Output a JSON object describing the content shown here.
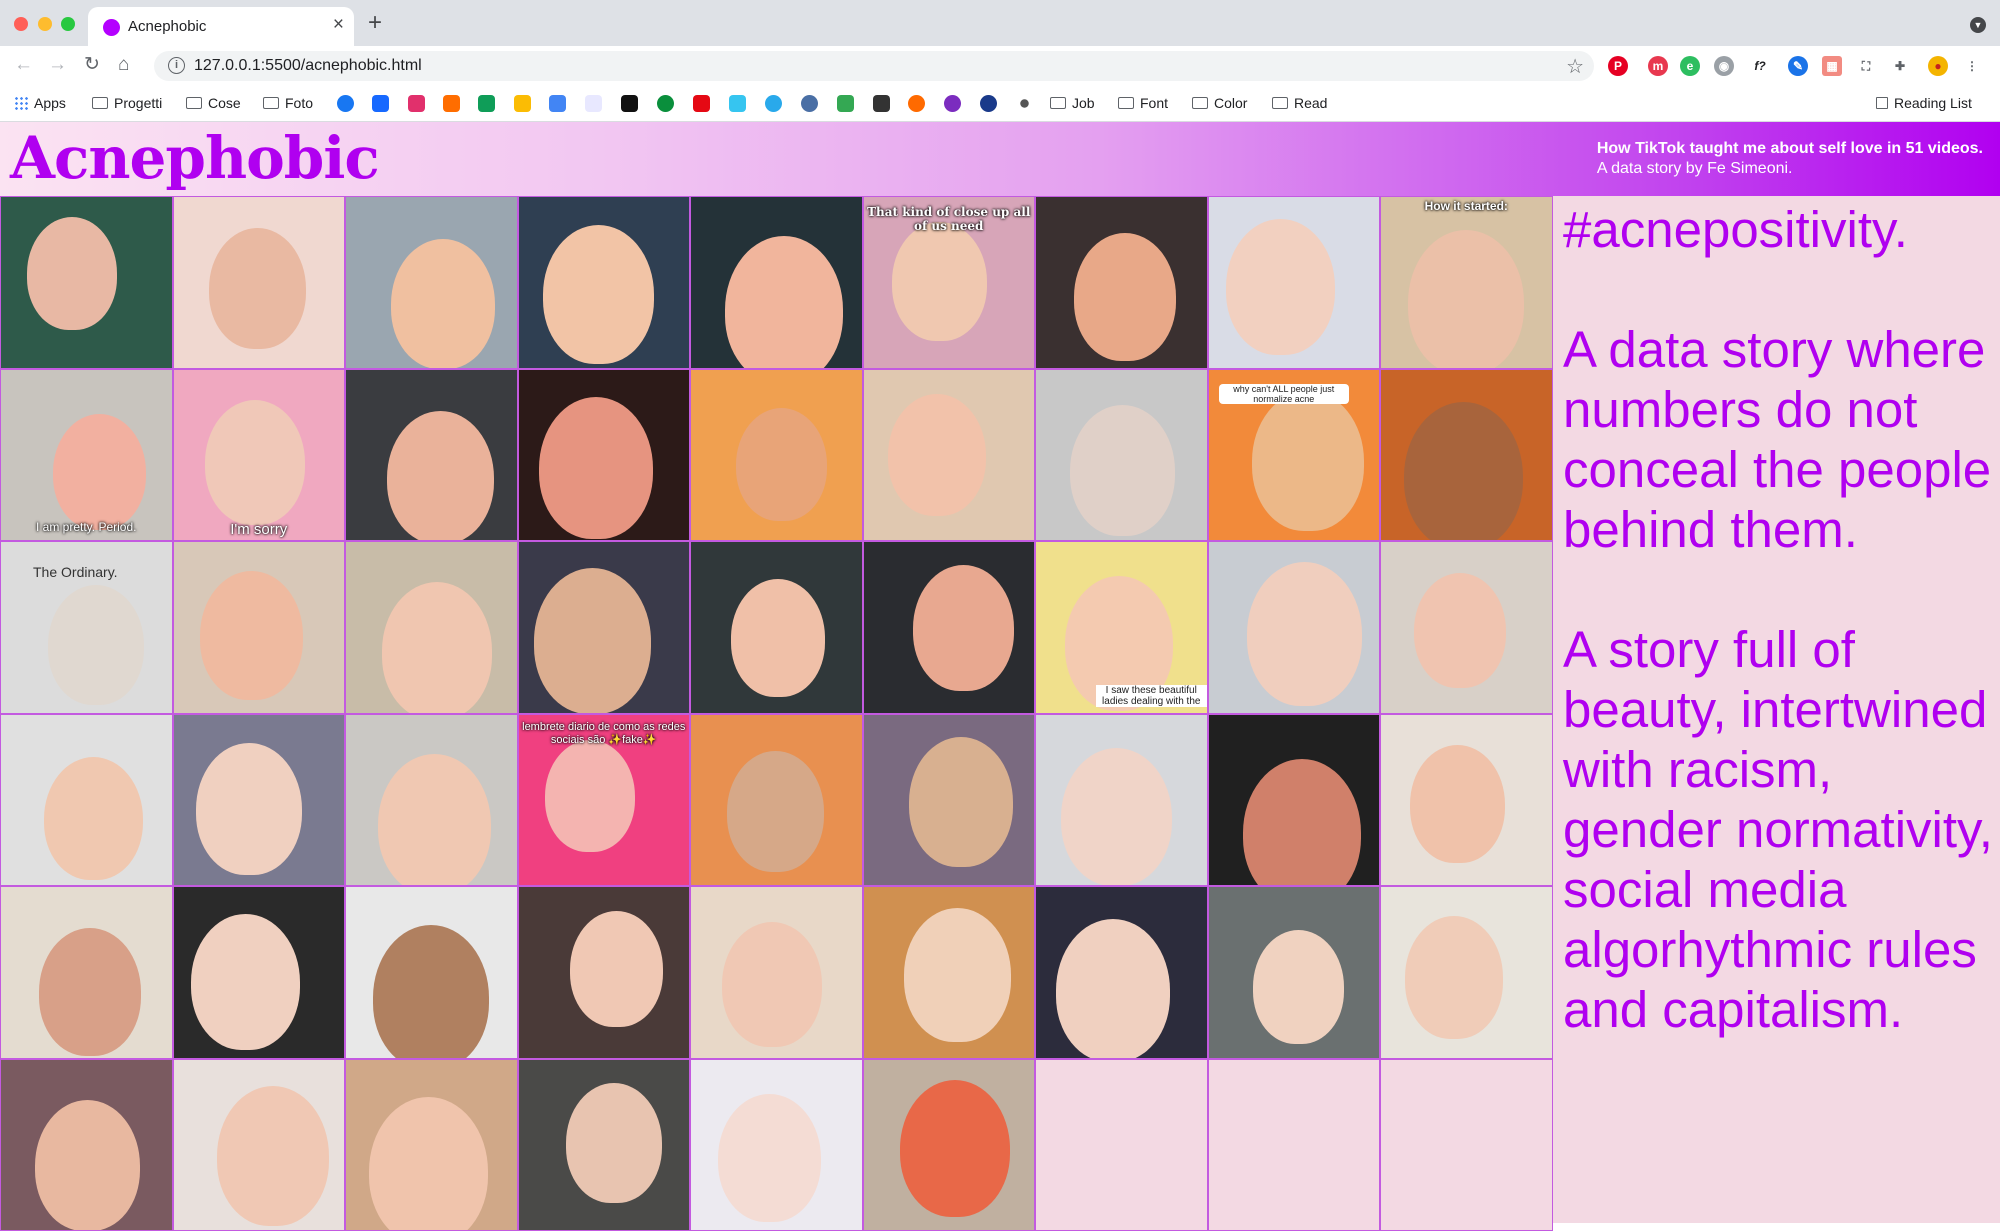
{
  "browser": {
    "tab_title": "Acnephobic",
    "url": "127.0.0.1:5500/acnephobic.html",
    "bookmarks": [
      "Apps",
      "Progetti",
      "Cose",
      "Foto",
      "Job",
      "Font",
      "Color",
      "Read"
    ],
    "reading_list": "Reading List",
    "icons": [
      "back-arrow-icon",
      "forward-arrow-icon",
      "reload-icon",
      "home-icon",
      "info-icon",
      "star-icon",
      "extensions-icon"
    ]
  },
  "header": {
    "logo": "Acnephobic",
    "tagline_1": "How TikTok taught me about self love in 51 videos.",
    "tagline_2": "A data story by Fe Simeoni."
  },
  "captions": {
    "c5": "That kind of close up all of us need",
    "c8": "How it started:",
    "c9": "I am pretty. Period.",
    "c10": "I'm sorry",
    "c16": "why can't ALL people just normalize acne",
    "c18": "The Ordinary.",
    "c24": "I saw these beautiful ladies dealing with the",
    "c30": "lembrete diario de como as redes sociais são ✨fake✨"
  },
  "story": {
    "p1": "#acnepositivity.",
    "p2": "A data story where numbers do not conceal the people behind them.",
    "p3": "A story full of beauty, intertwined with racism, gender normativity, social media algorhythmic rules and capitalism."
  }
}
